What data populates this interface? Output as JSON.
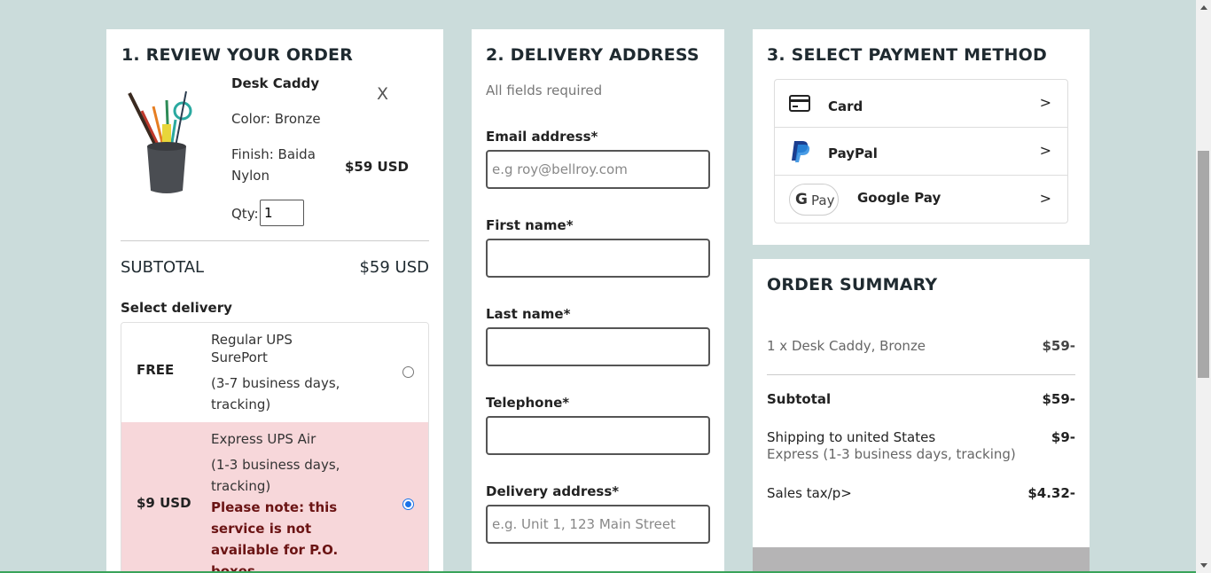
{
  "review": {
    "heading": "1. REVIEW YOUR ORDER",
    "product_name": "Desk Caddy",
    "color": "Color: Bronze",
    "finish_line1": "Finish: Baida",
    "finish_line2": "Nylon",
    "price": "$59 USD",
    "remove": "X",
    "qty_label": "Qty:",
    "qty_value": "1",
    "subtotal_label": "SUBTOTAL",
    "subtotal_value": "$59 USD",
    "select_delivery": "Select delivery",
    "options": [
      {
        "price": "FREE",
        "name_line1": "Regular UPS",
        "name_line2": "SurePort",
        "detail_line1": "(3-7 business days,",
        "detail_line2": "tracking)",
        "selected": false
      },
      {
        "price": "$9 USD",
        "name_line1": "Express UPS Air",
        "detail_line1": "(1-3 business days,",
        "detail_line2": "tracking)",
        "note_lines": [
          "Please note: this",
          "service is not",
          "available for P.O.",
          "boxes"
        ],
        "selected": true
      }
    ]
  },
  "delivery": {
    "heading": "2. DELIVERY ADDRESS",
    "subtitle": "All fields required",
    "email_label": "Email address*",
    "email_placeholder": "e.g roy@bellroy.com",
    "first_label": "First name*",
    "last_label": "Last name*",
    "phone_label": "Telephone*",
    "address_label": "Delivery address*",
    "address_placeholder": "e.g. Unit 1, 123 Main Street"
  },
  "payment": {
    "heading": "3. SELECT PAYMENT METHOD",
    "methods": [
      {
        "label": "Card",
        "icon": "card-icon"
      },
      {
        "label": "PayPal",
        "icon": "paypal-icon"
      },
      {
        "label": "Google Pay",
        "icon": "google-pay-icon",
        "badge": "Pay"
      }
    ],
    "chevron": ">"
  },
  "summary": {
    "heading": "ORDER SUMMARY",
    "item": "1 x Desk Caddy, Bronze",
    "item_price": "$59-",
    "subtotal_label": "Subtotal",
    "subtotal_value": "$59-",
    "shipping_label": "Shipping to united States",
    "shipping_detail": "Express (1-3 business days, tracking)",
    "shipping_value": "$9-",
    "tax_label": "Sales tax/p>",
    "tax_value": "$4.32-"
  },
  "colors": {
    "background": "#cbdcdb",
    "selected_option": "#f7d7da",
    "warning_text": "#6b1414",
    "accent": "#1a73e8"
  }
}
